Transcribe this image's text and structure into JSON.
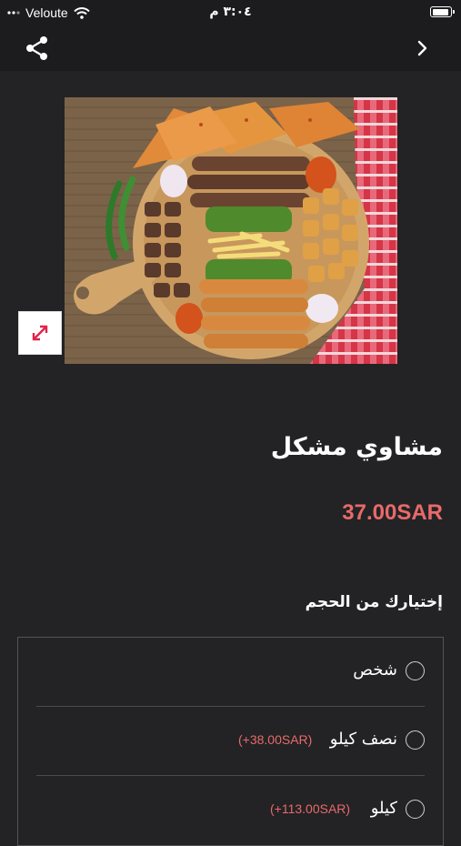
{
  "status_bar": {
    "carrier": "Veloute",
    "time": "٣:٠٤ م"
  },
  "header": {
    "share_icon": "share-icon",
    "back_icon": "chevron-right-icon"
  },
  "product": {
    "title": "مشاوي مشكل",
    "price": "37.00SAR",
    "expand_icon": "expand-icon"
  },
  "options": {
    "label": "إختيارك من الحجم",
    "items": [
      {
        "name": "شخص",
        "price": ""
      },
      {
        "name": "نصف كيلو",
        "price": "(+38.00SAR)"
      },
      {
        "name": "كيلو",
        "price": "(+113.00SAR)"
      }
    ]
  },
  "colors": {
    "background": "#232325",
    "bar": "#1c1c1e",
    "accent": "#e86a6a",
    "expand_icon": "#e0244a"
  }
}
